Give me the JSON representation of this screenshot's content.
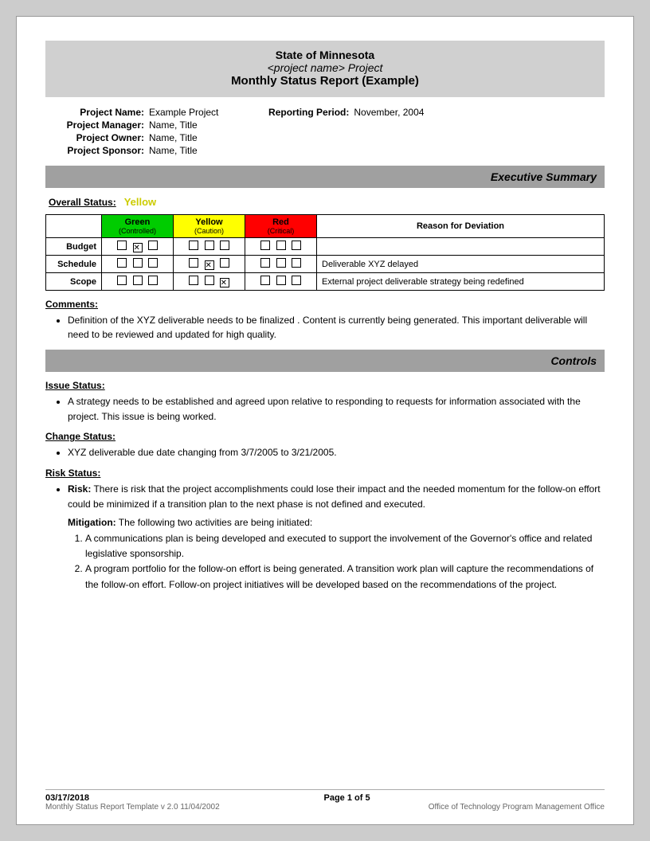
{
  "header": {
    "line1": "State of Minnesota",
    "line2": "<project name> Project",
    "line3": "Monthly Status Report (Example)"
  },
  "project_info": {
    "left": [
      {
        "label": "Project Name:",
        "value": "Example Project"
      },
      {
        "label": "Project Manager:",
        "value": "Name, Title"
      },
      {
        "label": "Project Owner:",
        "value": "Name, Title"
      },
      {
        "label": "Project Sponsor:",
        "value": "Name, Title"
      }
    ],
    "right": [
      {
        "label": "Reporting Period:",
        "value": "November, 2004"
      }
    ]
  },
  "executive_summary_banner": "Executive Summary",
  "overall_status_label": "Overall Status:",
  "overall_status_value": "Yellow",
  "status_table": {
    "headers": {
      "green": "Green",
      "green_sub": "(Controlled)",
      "yellow": "Yellow",
      "yellow_sub": "(Caution)",
      "red": "Red",
      "red_sub": "(Critical)",
      "reason": "Reason for Deviation"
    },
    "rows": [
      {
        "label": "Budget",
        "green": [
          false,
          true,
          false
        ],
        "yellow": [
          false,
          false,
          false
        ],
        "red": [
          false,
          false,
          false
        ],
        "reason": ""
      },
      {
        "label": "Schedule",
        "green": [
          false,
          false,
          false
        ],
        "yellow": [
          false,
          true,
          false
        ],
        "red": [
          false,
          false,
          false
        ],
        "reason": "Deliverable XYZ delayed"
      },
      {
        "label": "Scope",
        "green": [
          false,
          false,
          false
        ],
        "yellow": [
          false,
          false,
          true
        ],
        "red": [
          false,
          false,
          false
        ],
        "reason": "External project deliverable strategy being redefined"
      }
    ]
  },
  "comments": {
    "label": "Comments:",
    "items": [
      "Definition of the XYZ deliverable  needs to be finalized .  Content is currently being generated.  This important deliverable will need to be reviewed and updated for high quality."
    ]
  },
  "controls_banner": "Controls",
  "issue_status": {
    "label": "Issue Status:",
    "items": [
      "A strategy needs to be established and agreed upon relative to  responding to  requests for information associated with the project.  This issue is being worked."
    ]
  },
  "change_status": {
    "label": "Change Status:",
    "items": [
      "XYZ  deliverable due date changing from   3/7/2005 to 3/21/2005."
    ]
  },
  "risk_status": {
    "label": "Risk Status:",
    "risk_intro": "Risk:",
    "risk_text": "There is risk that the project accomplishments could lose their impact and the needed momentum for the follow-on effort could be   minimized if a transition plan to the next phase is not defined and executed.",
    "mitigation_intro": "Mitigation:",
    "mitigation_text": "The following two activities are being initiated:",
    "mitigation_items": [
      "A communications plan is being developed and executed to support the involvement of the Governor's office and related legislative sponsorship.",
      "A program portfolio for the follow-on effort is being generated.  A transition work plan will capture the recommendations of the follow-on effort. Follow-on project initiatives will be developed based on the recommendations of the project."
    ]
  },
  "footer": {
    "date": "03/17/2018",
    "page": "Page 1 of 5",
    "template": "Monthly Status Report Template  v 2.0  11/04/2002",
    "office": "Office of Technology Program Management Office"
  }
}
